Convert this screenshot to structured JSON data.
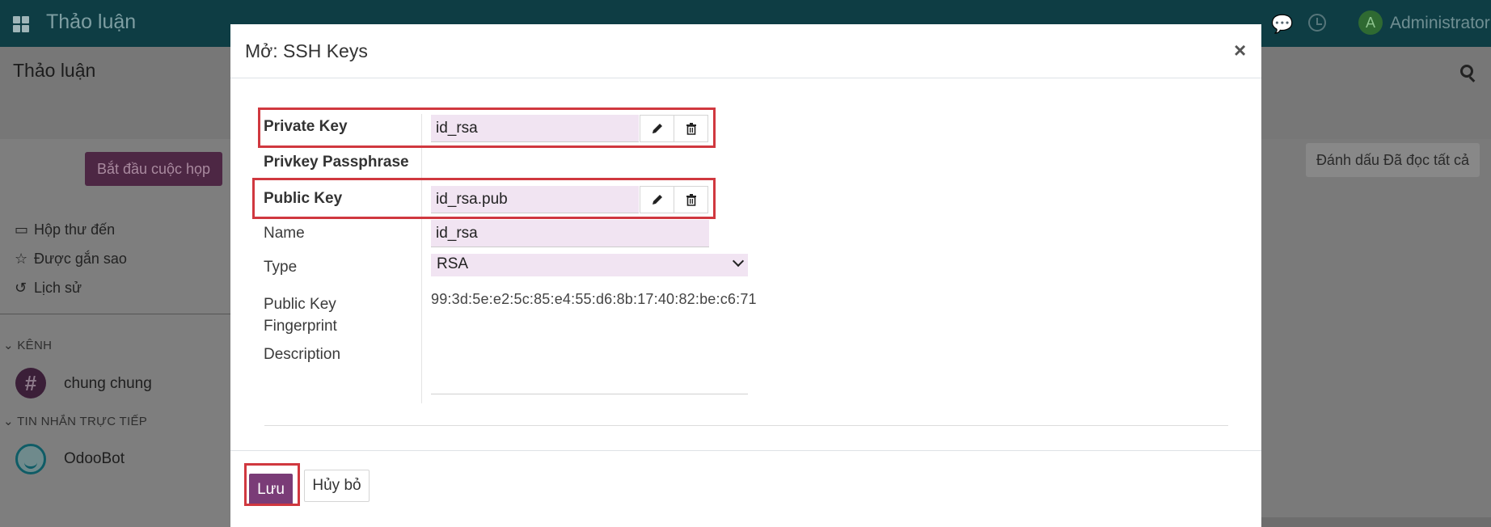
{
  "topbar": {
    "app_title": "Thảo luận",
    "user_initial": "A",
    "user_name": "Administrator"
  },
  "control_panel": {
    "title": "Thảo luận",
    "meeting_button": "Bắt đầu cuộc họp",
    "mark_all_read_button": "Đánh dấu Đã đọc tất cả"
  },
  "sidebar": {
    "items": [
      {
        "label": "Hộp thư đến",
        "icon": "inbox-icon"
      },
      {
        "label": "Được gắn sao",
        "icon": "star-icon"
      },
      {
        "label": "Lịch sử",
        "icon": "history-icon"
      }
    ],
    "channels_heading": "KÊNH",
    "channels": [
      {
        "name": "chung chung"
      }
    ],
    "direct_heading": "TIN NHẮN TRỰC TIẾP",
    "direct": [
      {
        "name": "OdooBot"
      }
    ]
  },
  "modal": {
    "title": "Mở: SSH Keys",
    "close_symbol": "×",
    "fields": {
      "private_key": {
        "label": "Private Key",
        "value": "id_rsa"
      },
      "privkey_passphrase": {
        "label": "Privkey Passphrase",
        "value": ""
      },
      "public_key": {
        "label": "Public Key",
        "value": "id_rsa.pub"
      },
      "name": {
        "label": "Name",
        "value": "id_rsa"
      },
      "type": {
        "label": "Type",
        "value": "RSA"
      },
      "fingerprint": {
        "label_line1": "Public Key",
        "label_line2": "Fingerprint",
        "value": "99:3d:5e:e2:5c:85:e4:55:d6:8b:17:40:82:be:c6:71"
      },
      "description": {
        "label": "Description",
        "value": ""
      }
    },
    "footer": {
      "save_label": "Lưu",
      "cancel_label": "Hủy bỏ"
    }
  },
  "colors": {
    "brand_purple": "#7a3c77",
    "highlight_red": "#d0383f",
    "field_bg": "#f1e4f2",
    "topbar": "#0e3d44"
  }
}
